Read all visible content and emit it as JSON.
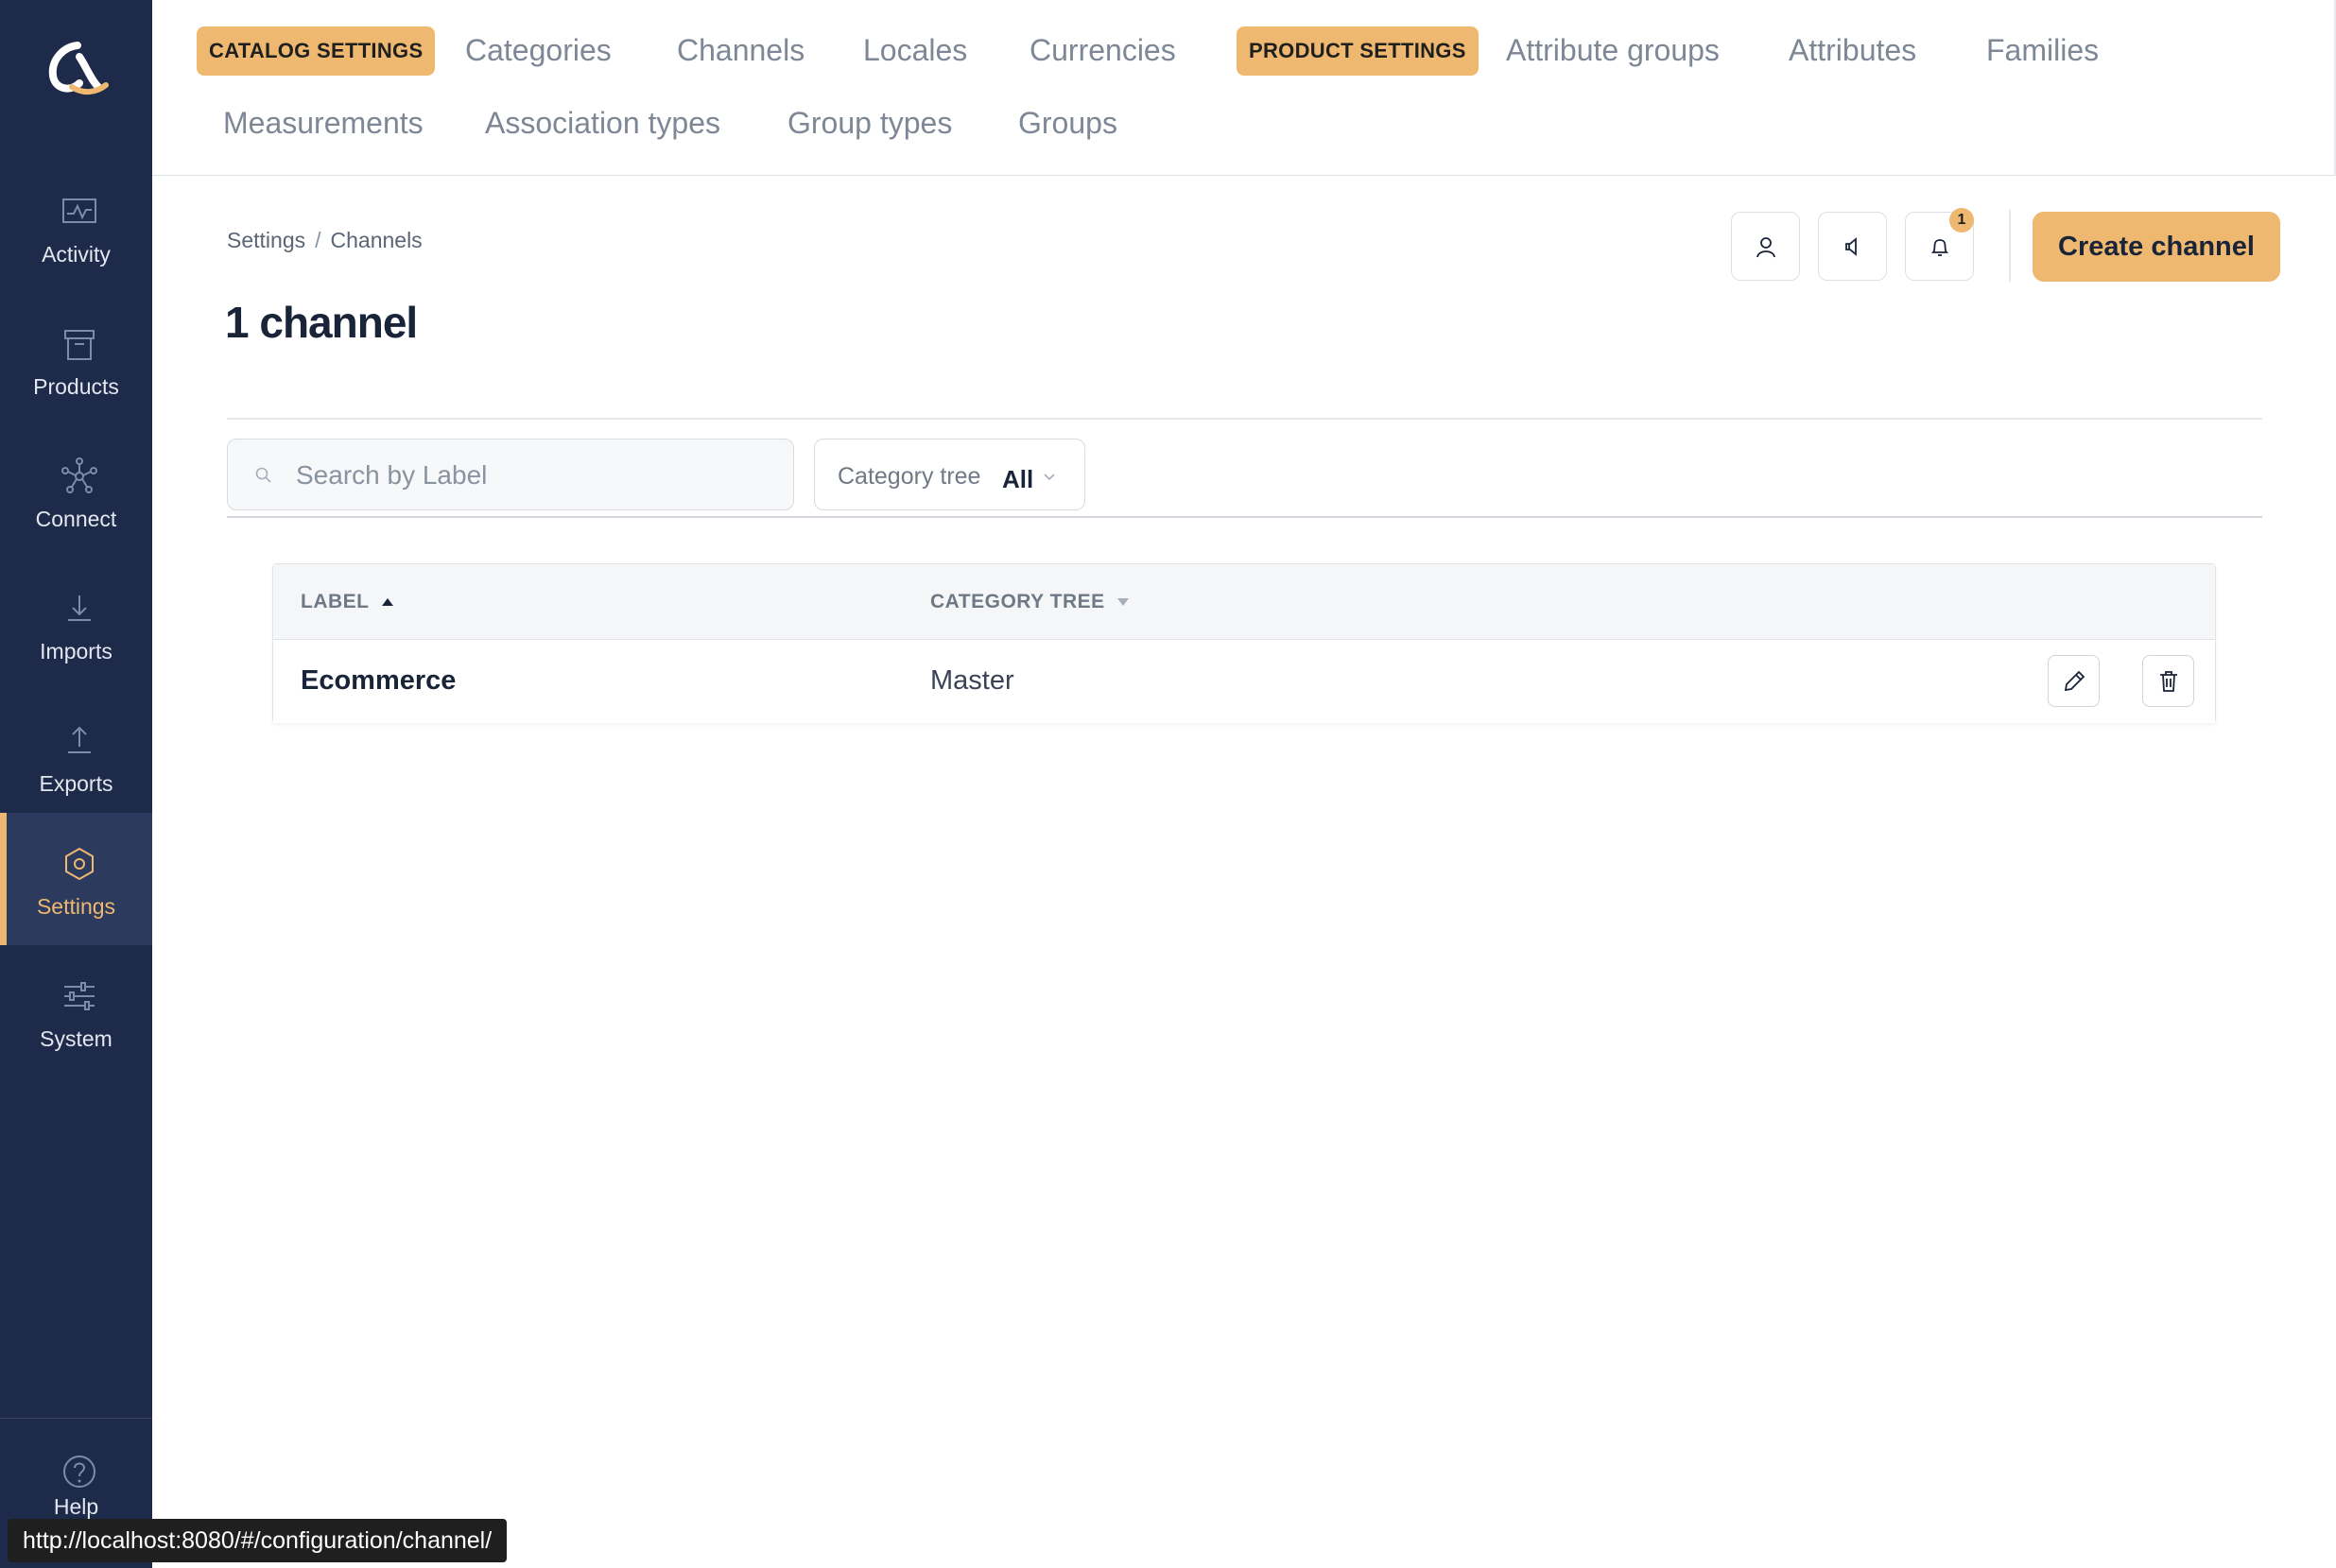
{
  "sidebar": {
    "items": [
      {
        "label": "Activity",
        "icon": "activity-icon"
      },
      {
        "label": "Products",
        "icon": "products-icon"
      },
      {
        "label": "Connect",
        "icon": "connect-icon"
      },
      {
        "label": "Imports",
        "icon": "imports-icon"
      },
      {
        "label": "Exports",
        "icon": "exports-icon"
      },
      {
        "label": "Settings",
        "icon": "settings-icon",
        "active": true
      },
      {
        "label": "System",
        "icon": "system-icon"
      }
    ],
    "help_label": "Help"
  },
  "topnav": {
    "catalog_pill": "CATALOG SETTINGS",
    "product_pill": "PRODUCT SETTINGS",
    "links": [
      "Categories",
      "Channels",
      "Locales",
      "Currencies",
      "Attribute groups",
      "Attributes",
      "Families",
      "Measurements",
      "Association types",
      "Group types",
      "Groups"
    ]
  },
  "breadcrumb": {
    "root": "Settings",
    "separator": "/",
    "current": "Channels"
  },
  "page_title": "1 channel",
  "notification_count": "1",
  "create_button": "Create channel",
  "search": {
    "placeholder": "Search by Label",
    "value": ""
  },
  "filter": {
    "label": "Category tree",
    "value": "All"
  },
  "table": {
    "columns": [
      {
        "label": "LABEL",
        "sort": "ascending"
      },
      {
        "label": "CATEGORY TREE",
        "sort": "none"
      }
    ],
    "rows": [
      {
        "label": "Ecommerce",
        "category_tree": "Master"
      }
    ]
  },
  "status_url": "http://localhost:8080/#/configuration/channel/",
  "colors": {
    "sidebar": "#1e2a4a",
    "accent": "#efb870",
    "text_dark": "#1a2438",
    "text_muted": "#7d8795"
  }
}
